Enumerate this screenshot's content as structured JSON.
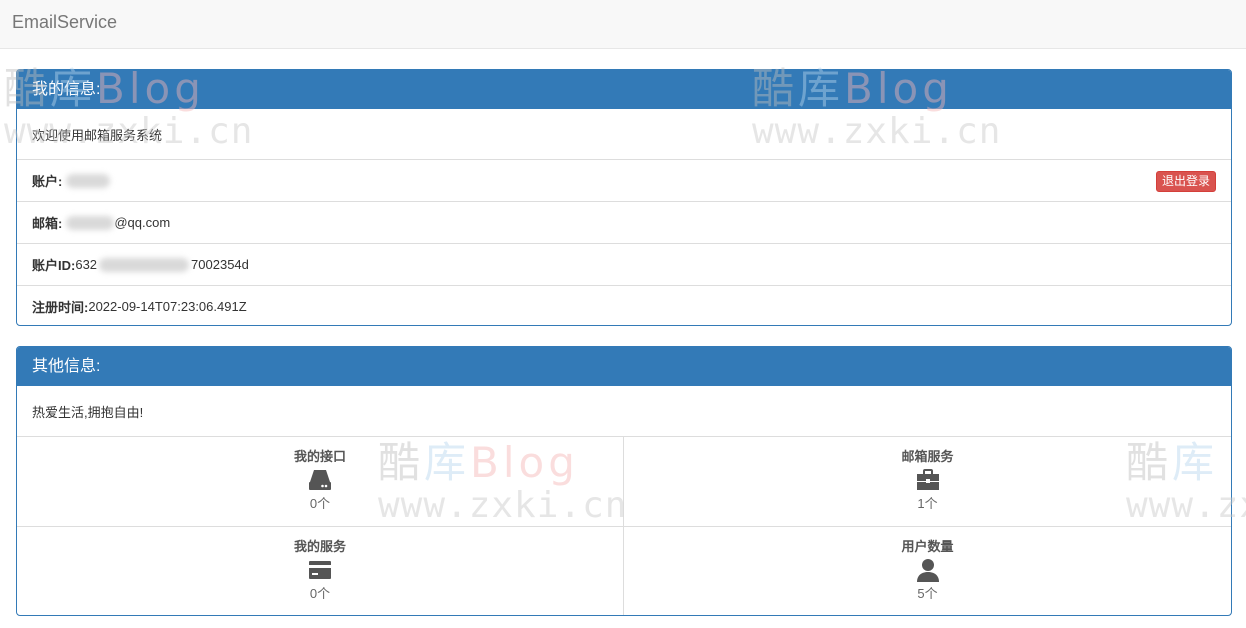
{
  "navbar": {
    "brand": "EmailService"
  },
  "my_info": {
    "heading": "我的信息:",
    "welcome": "欢迎使用邮箱服务系统",
    "rows": {
      "account": {
        "label": "账户:",
        "value": ""
      },
      "email": {
        "label": "邮箱:",
        "value": "@qq.com"
      },
      "account_id": {
        "label": "账户ID:",
        "value_prefix": "632",
        "value_suffix": "7002354d"
      },
      "register_time": {
        "label": "注册时间:",
        "value": "2022-09-14T07:23:06.491Z"
      }
    },
    "logout_label": "退出登录"
  },
  "other_info": {
    "heading": "其他信息:",
    "motto": "热爱生活,拥抱自由!",
    "stats": [
      {
        "title": "我的接口",
        "icon": "hdd-icon",
        "count": "0个"
      },
      {
        "title": "邮箱服务",
        "icon": "briefcase-icon",
        "count": "1个"
      },
      {
        "title": "我的服务",
        "icon": "credit-card-icon",
        "count": "0个"
      },
      {
        "title": "用户数量",
        "icon": "user-icon",
        "count": "5个"
      }
    ]
  },
  "watermark": {
    "cn_1": "酷",
    "cn_2": "库",
    "latin": "Blog",
    "url": "www.zxki.cn"
  },
  "colors": {
    "primary": "#337ab7",
    "danger": "#d9534f",
    "icon": "#555555"
  }
}
